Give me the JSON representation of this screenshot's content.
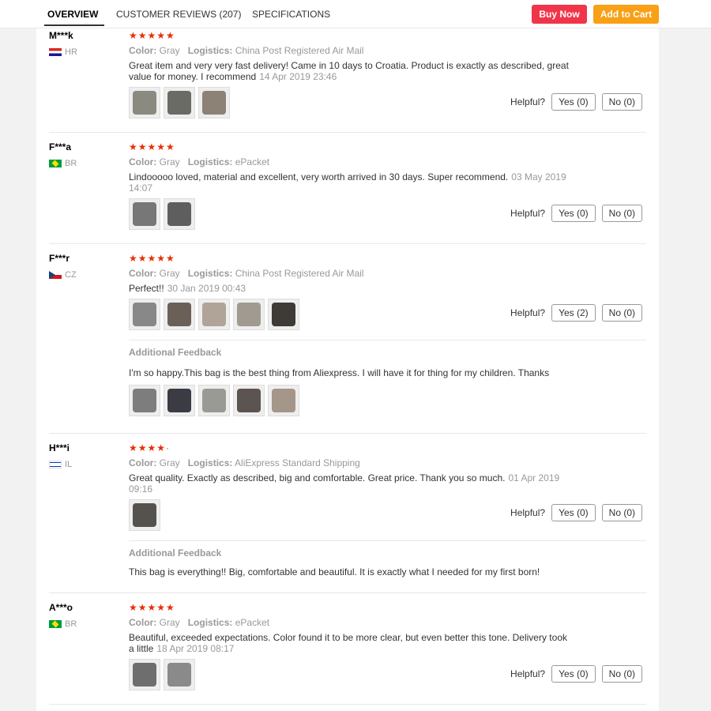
{
  "tabs": [
    {
      "label": "OVERVIEW"
    },
    {
      "label": "CUSTOMER REVIEWS (207)"
    },
    {
      "label": "SPECIFICATIONS"
    }
  ],
  "actions": {
    "buy_now": "Buy Now",
    "add_to_cart": "Add to Cart"
  },
  "labels": {
    "color": "Color:",
    "logistics": "Logistics:",
    "helpful": "Helpful?",
    "additional_feedback": "Additional Feedback"
  },
  "colors": {
    "buy_now": "#f0354a",
    "add_to_cart": "#f8a016",
    "stars": "#e62e04"
  },
  "reviews": [
    {
      "user": "M***k",
      "country": "HR",
      "flag": "croatia-flag-icon",
      "stars": "★★★★★",
      "color": "Gray",
      "logistics": "China Post Registered Air Mail",
      "text": "Great item and very very fast delivery! Came in 10 days to Croatia. Product is exactly as described, great value for money. I recommend",
      "date": "14 Apr 2019 23:46",
      "yes": "Yes (0)",
      "no": "No (0)"
    },
    {
      "user": "F***a",
      "country": "BR",
      "flag": "brazil-flag-icon",
      "stars": "★★★★★",
      "color": "Gray",
      "logistics": "ePacket",
      "text": "Lindooooo loved, material and excellent, very worth arrived in 30 days. Super recommend.",
      "date": "03 May 2019 14:07",
      "yes": "Yes (0)",
      "no": "No (0)"
    },
    {
      "user": "F***r",
      "country": "CZ",
      "flag": "czech-flag-icon",
      "stars": "★★★★★",
      "color": "Gray",
      "logistics": "China Post Registered Air Mail",
      "text": "Perfect!!",
      "date": "30 Jan 2019 00:43",
      "yes": "Yes (2)",
      "no": "No (0)",
      "additional": "I'm so happy.This bag is the best thing from Aliexpress. I will have it for thing for my children. Thanks"
    },
    {
      "user": "H***i",
      "country": "IL",
      "flag": "israel-flag-icon",
      "stars": "★★★★·",
      "color": "Gray",
      "logistics": "AliExpress Standard Shipping",
      "text": "Great quality. Exactly as described, big and comfortable. Great price. Thank you so much.",
      "date": "01 Apr 2019 09:16",
      "yes": "Yes (0)",
      "no": "No (0)",
      "additional": "This bag is everything!! Big, comfortable and beautiful. It is exactly what I needed for my first born!"
    },
    {
      "user": "A***o",
      "country": "BR",
      "flag": "brazil-flag-icon",
      "stars": "★★★★★",
      "color": "Gray",
      "logistics": "ePacket",
      "text": "Beautiful, exceeded expectations. Color found it to be more clear, but even better this tone. Delivery took a little",
      "date": "18 Apr 2019 08:17",
      "yes": "Yes (0)",
      "no": "No (0)"
    }
  ]
}
